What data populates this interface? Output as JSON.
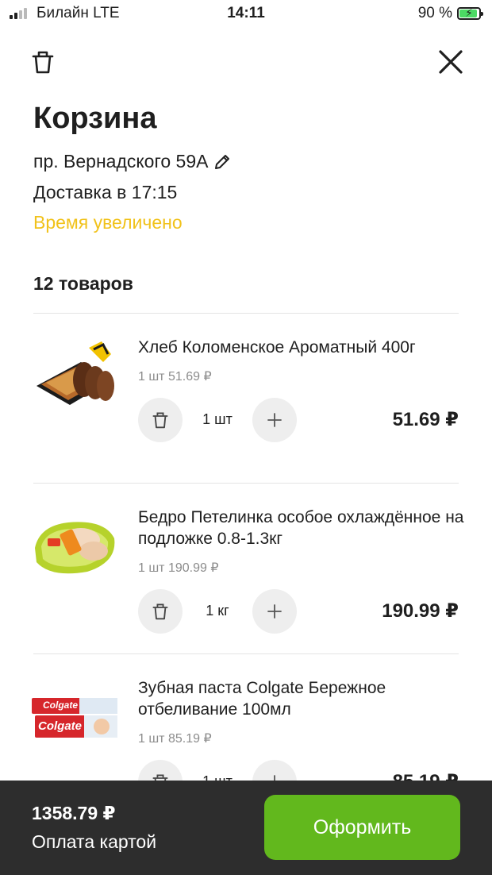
{
  "status_bar": {
    "carrier": "Билайн  LTE",
    "time": "14:11",
    "battery": "90 %",
    "battery_level": 0.9
  },
  "header": {
    "trash_icon": "trash-icon",
    "close_icon": "close-icon"
  },
  "cart": {
    "title": "Корзина",
    "address": "пр. Вернадского 59А",
    "edit_icon": "pencil-icon",
    "delivery": "Доставка в 17:15",
    "time_note": "Время увеличено",
    "time_note_color": "#f1c21b",
    "count": "12 товаров"
  },
  "items": [
    {
      "name": "Хлеб Коломенское Ароматный 400г",
      "unit_price": "1 шт 51.69 ₽",
      "qty": "1 шт",
      "total": "51.69 ₽"
    },
    {
      "name": "Бедро Петелинка особое охлаждённое на подложке 0.8-1.3кг",
      "unit_price": "1 шт 190.99 ₽",
      "qty": "1 кг",
      "total": "190.99 ₽"
    },
    {
      "name": "Зубная паста Colgate Бережное отбеливание 100мл",
      "unit_price": "1 шт 85.19 ₽",
      "qty": "1 шт",
      "total": "85.19 ₽",
      "thumb_text": "Colgate"
    }
  ],
  "footer": {
    "total": "1358.79 ₽",
    "payment": "Оплата картой",
    "checkout": "Оформить",
    "checkout_color": "#62b81d"
  }
}
